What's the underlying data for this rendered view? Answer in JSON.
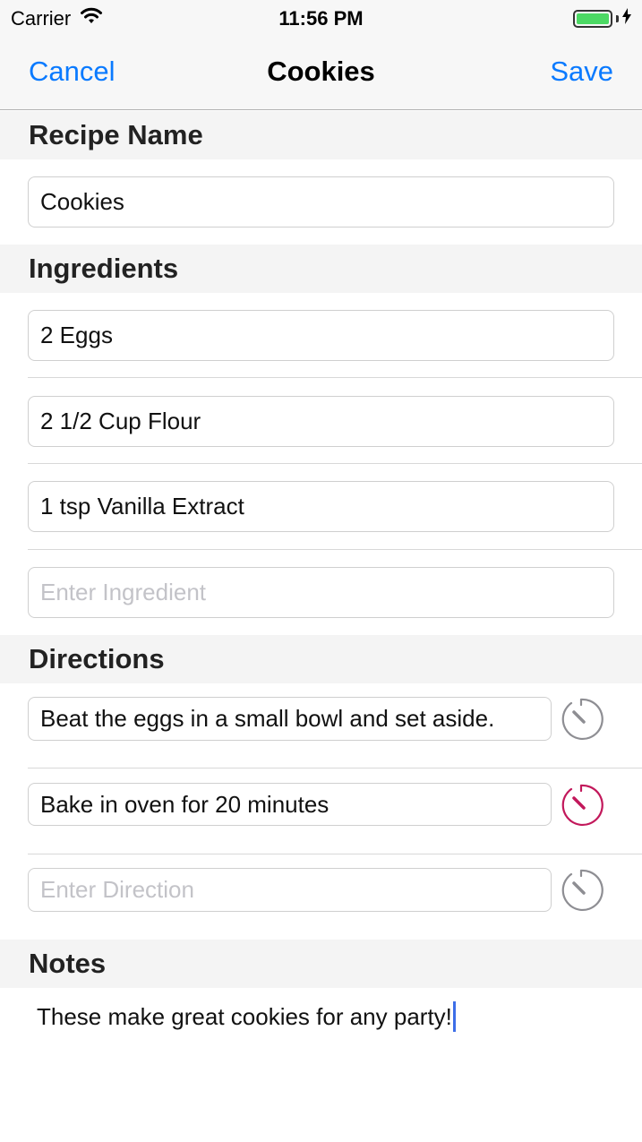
{
  "status": {
    "carrier": "Carrier",
    "time": "11:56 PM"
  },
  "nav": {
    "cancel": "Cancel",
    "title": "Cookies",
    "save": "Save"
  },
  "sections": {
    "recipe_name": "Recipe Name",
    "ingredients": "Ingredients",
    "directions": "Directions",
    "notes": "Notes"
  },
  "recipe_name_value": "Cookies",
  "ingredients": [
    "2 Eggs",
    "2 1/2 Cup Flour",
    "1 tsp Vanilla Extract"
  ],
  "ingredient_placeholder": "Enter Ingredient",
  "directions": [
    "Beat the eggs in a small bowl and set aside.",
    "Bake in oven for 20 minutes"
  ],
  "direction_placeholder": "Enter Direction",
  "notes_value": "These make great cookies for any party!",
  "colors": {
    "accent": "#0a7aff",
    "timer_active": "#c2185b",
    "timer_inactive": "#8e8e93",
    "battery": "#4cd964"
  },
  "icons": {
    "wifi": "wifi-icon",
    "battery": "battery-icon",
    "charging": "charging-bolt-icon",
    "timer": "timer-icon"
  },
  "timers_active": [
    false,
    true,
    false
  ]
}
